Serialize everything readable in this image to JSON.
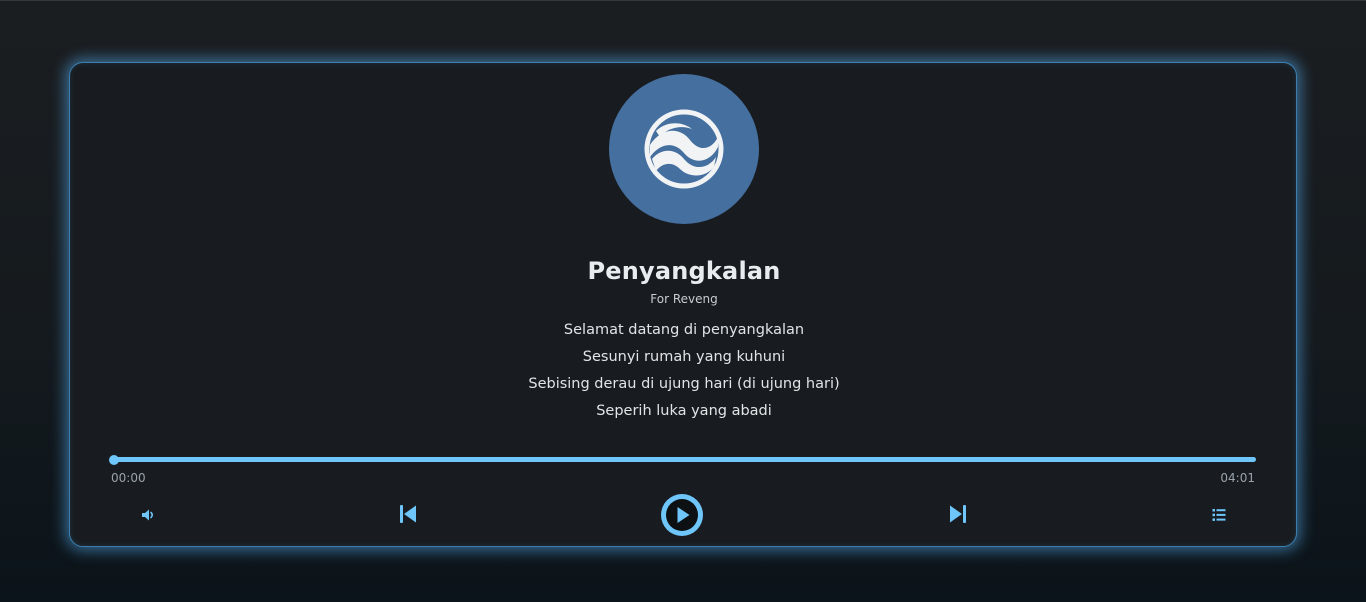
{
  "track": {
    "title": "Penyangkalan",
    "artist": "For Reveng",
    "lyrics": [
      "Selamat datang di penyangkalan",
      "Sesunyi rumah yang kuhuni",
      "Sebising derau di ujung hari (di ujung hari)",
      "Seperih luka yang abadi"
    ]
  },
  "progress": {
    "current_time": "00:00",
    "total_time": "04:01",
    "fill_fraction": 1.0,
    "thumb_fraction": 0.0
  },
  "controls": {
    "volume_icon": "volume-icon",
    "previous_icon": "skip-previous-icon",
    "play_icon": "play-icon",
    "next_icon": "skip-next-icon",
    "playlist_icon": "playlist-icon"
  },
  "colors": {
    "accent": "#6ec6fb",
    "card_background": "#181c20",
    "cover_background": "#456f9f",
    "glow": "#54aaeb"
  }
}
